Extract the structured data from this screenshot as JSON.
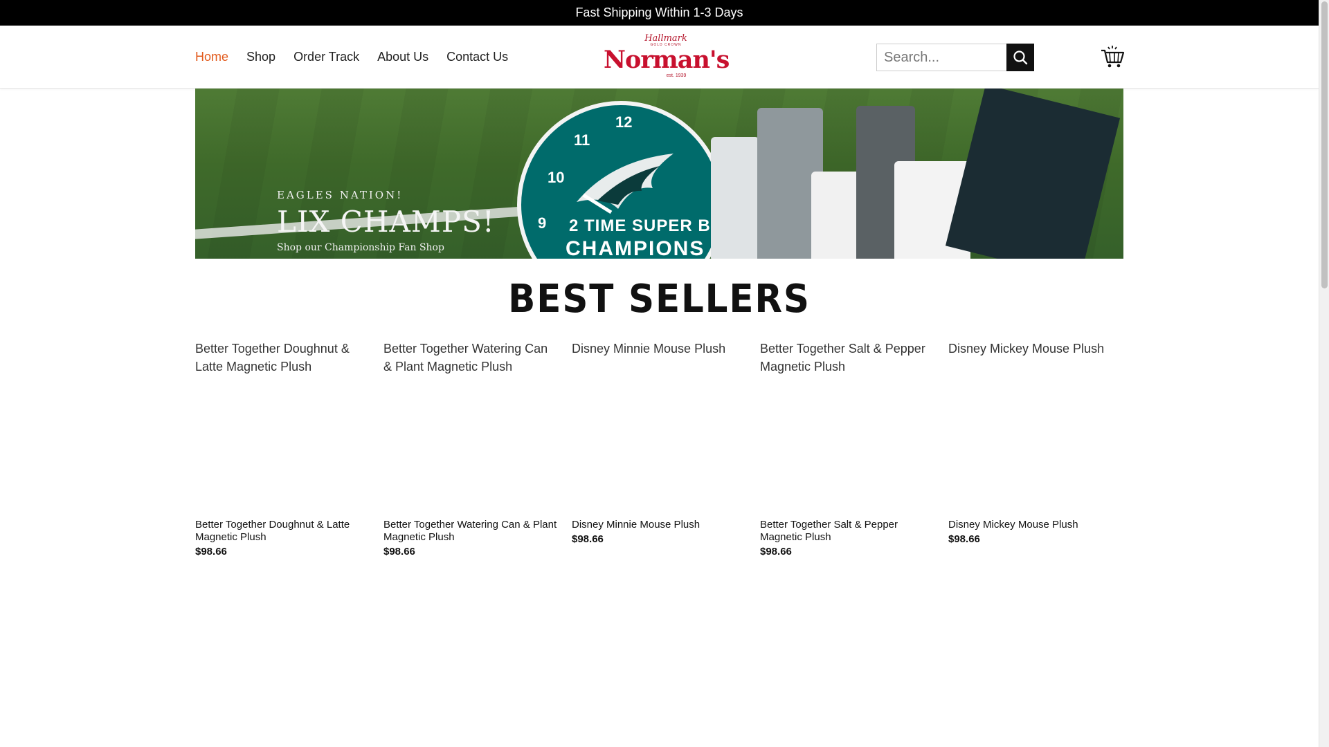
{
  "topbar": {
    "text": "Fast Shipping Within 1-3 Days"
  },
  "nav": {
    "items": [
      {
        "label": "Home",
        "active": true
      },
      {
        "label": "Shop"
      },
      {
        "label": "Order Track"
      },
      {
        "label": "About Us"
      },
      {
        "label": "Contact Us"
      }
    ]
  },
  "logo": {
    "top": "Hallmark",
    "sub": "GOLD CROWN",
    "brand": "Norman's",
    "est": "est. 1939"
  },
  "search": {
    "placeholder": "Search...",
    "icon": "search-icon"
  },
  "cart": {
    "icon": "cart-icon"
  },
  "banner": {
    "line1": "EAGLES NATION!",
    "title": "LIX CHAMPS!",
    "line2": "Shop our Championship Fan Shop",
    "clock_text1": "2 TIME SUPER BOWL",
    "clock_text2": "CHAMPIONS"
  },
  "section": {
    "title": "BEST SELLERS"
  },
  "products": [
    {
      "name": "Better Together Doughnut & Latte Magnetic Plush",
      "price": "$98.66"
    },
    {
      "name": "Better Together Watering Can & Plant Magnetic Plush",
      "price": "$98.66"
    },
    {
      "name": "Disney Minnie Mouse Plush",
      "price": "$98.66"
    },
    {
      "name": "Better Together Salt & Pepper Magnetic Plush",
      "price": "$98.66"
    },
    {
      "name": "Disney Mickey Mouse Plush",
      "price": "$98.66"
    }
  ],
  "colors": {
    "accent": "#e25a1c",
    "brand": "#c8102e",
    "topbar": "#000000"
  }
}
